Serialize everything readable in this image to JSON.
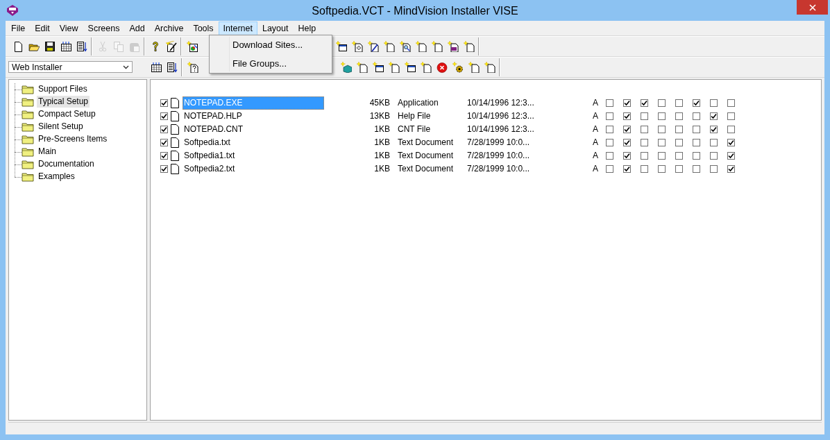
{
  "window": {
    "title": "Softpedia.VCT - MindVision Installer VISE"
  },
  "menu": [
    {
      "label": "File",
      "selected": false
    },
    {
      "label": "Edit",
      "selected": false
    },
    {
      "label": "View",
      "selected": false
    },
    {
      "label": "Screens",
      "selected": false
    },
    {
      "label": "Add",
      "selected": false
    },
    {
      "label": "Archive",
      "selected": false
    },
    {
      "label": "Tools",
      "selected": false
    },
    {
      "label": "Internet",
      "selected": true
    },
    {
      "label": "Layout",
      "selected": false
    },
    {
      "label": "Help",
      "selected": false
    }
  ],
  "open_menu": {
    "items": [
      "Download Sites...",
      "File Groups..."
    ]
  },
  "toolbar_1": [
    [
      {
        "kind": "new",
        "disabled": false
      },
      {
        "kind": "open",
        "disabled": false
      },
      {
        "kind": "save",
        "disabled": false
      },
      {
        "kind": "grid",
        "disabled": false
      },
      {
        "kind": "sort",
        "disabled": false
      }
    ],
    [
      {
        "kind": "cut",
        "disabled": true
      },
      {
        "kind": "copy",
        "disabled": true
      },
      {
        "kind": "paste",
        "disabled": true
      }
    ],
    [
      {
        "kind": "help",
        "disabled": false
      },
      {
        "kind": "wand",
        "disabled": false
      }
    ],
    [
      {
        "kind": "sparkle-chart",
        "disabled": false
      },
      {
        "kind": "sparkle-window",
        "disabled": false
      },
      {
        "kind": "sparkle-tag",
        "disabled": false
      },
      {
        "kind": "sparkle-pen",
        "disabled": false
      },
      {
        "kind": "sparkle-page",
        "disabled": false
      },
      {
        "kind": "sparkle-magnifier",
        "disabled": false
      },
      {
        "kind": "sparkle-page",
        "disabled": false
      },
      {
        "kind": "sparkle-page",
        "disabled": false
      },
      {
        "kind": "sparkle-printer",
        "disabled": false
      },
      {
        "kind": "sparkle-page",
        "disabled": false
      }
    ]
  ],
  "installer_dropdown": {
    "value": "Web Installer"
  },
  "toolbar_2": [
    [
      {
        "kind": "grid",
        "disabled": false
      },
      {
        "kind": "sort",
        "disabled": false
      }
    ],
    [
      {
        "kind": "sparkle-help",
        "disabled": false
      },
      {
        "kind": "sparkle-cube",
        "disabled": false
      },
      {
        "kind": "sparkle-page",
        "disabled": false
      },
      {
        "kind": "sparkle-window",
        "disabled": false
      },
      {
        "kind": "sparkle-page",
        "disabled": false
      },
      {
        "kind": "sparkle-window",
        "disabled": false
      },
      {
        "kind": "sparkle-page",
        "disabled": false
      },
      {
        "kind": "sparkle-stop",
        "disabled": false
      },
      {
        "kind": "sparkle-gear",
        "disabled": false
      },
      {
        "kind": "sparkle-page",
        "disabled": false
      },
      {
        "kind": "sparkle-page",
        "disabled": false
      }
    ]
  ],
  "tree": [
    {
      "label": "Support Files",
      "selected": false
    },
    {
      "label": "Typical Setup",
      "selected": true
    },
    {
      "label": "Compact Setup",
      "selected": false
    },
    {
      "label": "Silent Setup",
      "selected": false
    },
    {
      "label": "Pre-Screens Items",
      "selected": false
    },
    {
      "label": "Main",
      "selected": false
    },
    {
      "label": "Documentation",
      "selected": false
    },
    {
      "label": "Examples",
      "selected": false
    }
  ],
  "files": [
    {
      "checked": true,
      "name": "NOTEPAD.EXE",
      "selected": true,
      "size": "45KB",
      "type": "Application",
      "modified": "10/14/1996 12:3...",
      "column_6": "A",
      "flags": [
        false,
        true,
        true,
        false,
        false,
        true,
        false,
        false
      ]
    },
    {
      "checked": true,
      "name": "NOTEPAD.HLP",
      "selected": false,
      "size": "13KB",
      "type": "Help File",
      "modified": "10/14/1996 12:3...",
      "column_6": "A",
      "flags": [
        false,
        true,
        false,
        false,
        false,
        false,
        true,
        false
      ]
    },
    {
      "checked": true,
      "name": "NOTEPAD.CNT",
      "selected": false,
      "size": "1KB",
      "type": "CNT File",
      "modified": "10/14/1996 12:3...",
      "column_6": "A",
      "flags": [
        false,
        true,
        false,
        false,
        false,
        false,
        true,
        false
      ]
    },
    {
      "checked": true,
      "name": "Softpedia.txt",
      "selected": false,
      "size": "1KB",
      "type": "Text Document",
      "modified": "7/28/1999 10:0...",
      "column_6": "A",
      "flags": [
        false,
        true,
        false,
        false,
        false,
        false,
        false,
        true
      ]
    },
    {
      "checked": true,
      "name": "Softpedia1.txt",
      "selected": false,
      "size": "1KB",
      "type": "Text Document",
      "modified": "7/28/1999 10:0...",
      "column_6": "A",
      "flags": [
        false,
        true,
        false,
        false,
        false,
        false,
        false,
        true
      ]
    },
    {
      "checked": true,
      "name": "Softpedia2.txt",
      "selected": false,
      "size": "1KB",
      "type": "Text Document",
      "modified": "7/28/1999 10:0...",
      "column_6": "A",
      "flags": [
        false,
        true,
        false,
        false,
        false,
        false,
        false,
        true
      ]
    }
  ]
}
